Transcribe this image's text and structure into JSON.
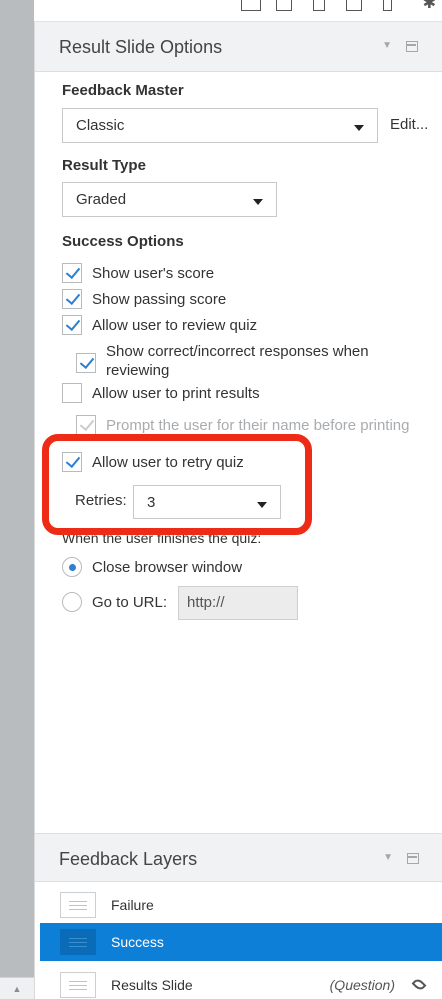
{
  "panel": {
    "title": "Result Slide Options"
  },
  "feedback_master": {
    "label": "Feedback Master",
    "value": "Classic",
    "edit_label": "Edit..."
  },
  "result_type": {
    "label": "Result Type",
    "value": "Graded"
  },
  "success_options": {
    "label": "Success Options",
    "items": [
      {
        "label": "Show user's score",
        "checked": true,
        "enabled": true
      },
      {
        "label": "Show passing score",
        "checked": true,
        "enabled": true
      },
      {
        "label": "Allow user to review quiz",
        "checked": true,
        "enabled": true
      },
      {
        "label": "Show correct/incorrect responses when reviewing",
        "line1": "Show correct/incorrect responses when",
        "line2": "reviewing",
        "checked": true,
        "enabled": true
      },
      {
        "label": "Allow user to print results",
        "checked": false,
        "enabled": true
      },
      {
        "label": "Prompt the user for their name before printing",
        "checked": true,
        "enabled": false
      },
      {
        "label": "Allow user to retry quiz",
        "checked": true,
        "enabled": true
      }
    ]
  },
  "retries": {
    "label": "Retries:",
    "value": "3"
  },
  "finish": {
    "label": "When the user finishes the quiz:",
    "options": [
      {
        "label": "Close browser window",
        "selected": true
      },
      {
        "label": "Go to URL:",
        "selected": false
      }
    ],
    "url_value": "http://"
  },
  "feedback_layers": {
    "title": "Feedback Layers",
    "items": [
      {
        "name": "Failure",
        "tag": "",
        "selected": false
      },
      {
        "name": "Success",
        "tag": "",
        "selected": true
      },
      {
        "name": "Results Slide",
        "tag": "(Question)",
        "selected": false
      }
    ]
  },
  "colors": {
    "accent": "#2c7fd3",
    "selected_row": "#0e7fd6",
    "highlight": "#ee2b16",
    "gutter": "#b9bcbf"
  },
  "icons": [
    "slide-icon",
    "desktop-icon",
    "tablet-icon",
    "phone-icon",
    "gear-icon",
    "restore-icon",
    "eye-icon",
    "scroll-up-icon"
  ]
}
